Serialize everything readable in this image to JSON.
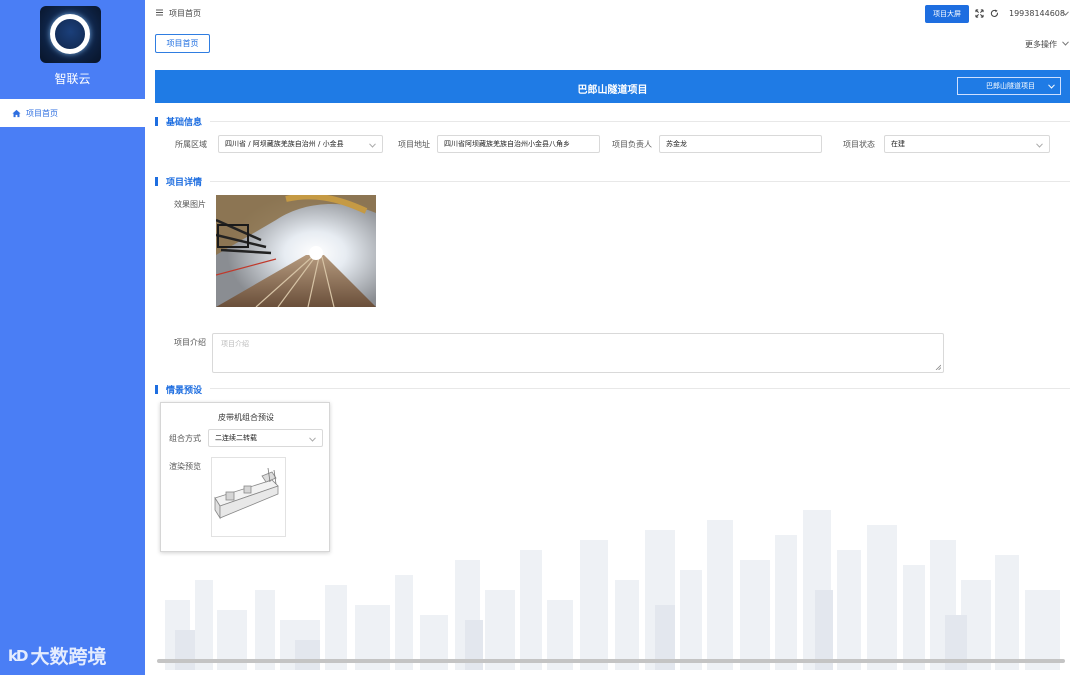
{
  "sidebar": {
    "app_name": "智联云",
    "nav_items": [
      {
        "label": "项目首页",
        "icon": "home-icon",
        "active": true
      }
    ],
    "watermark_text": "大数跨境",
    "watermark_logo": "kD"
  },
  "topbar": {
    "breadcrumb": "项目首页",
    "big_screen_button": "项目大屏",
    "username": "19938144608"
  },
  "tabs": [
    {
      "label": "项目首页",
      "active": true
    }
  ],
  "more_actions_label": "更多操作",
  "project": {
    "title": "巴郎山隧道项目",
    "selector_value": "巴郎山隧道项目"
  },
  "basic_info": {
    "section_title": "基础信息",
    "region_label": "所属区域",
    "region_value": "四川省 / 阿坝藏族羌族自治州 / 小金县",
    "address_label": "项目地址",
    "address_value": "四川省阿坝藏族羌族自治州小金县八角乡",
    "owner_label": "项目负责人",
    "owner_value": "苏金龙",
    "status_label": "项目状态",
    "status_value": "在建"
  },
  "details": {
    "section_title": "项目详情",
    "image_label": "效果图片",
    "intro_label": "项目介绍",
    "intro_placeholder": "项目介绍"
  },
  "scene": {
    "section_title": "情景预设",
    "card_title": "皮带机组合预设",
    "combo_label": "组合方式",
    "combo_value": "二连续二转载",
    "preview_label": "渲染预览"
  },
  "colors": {
    "sidebar": "#4a7ef5",
    "primary": "#1e6ee0",
    "header_band": "#1f7be5"
  }
}
